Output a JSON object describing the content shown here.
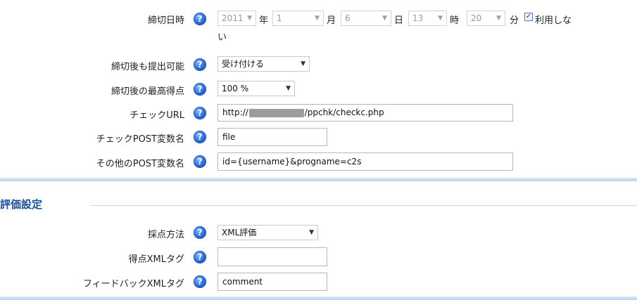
{
  "deadline": {
    "label": "締切日時",
    "year": "2011",
    "year_unit": "年",
    "month": "1",
    "month_unit": "月",
    "day": "6",
    "day_unit": "日",
    "hour": "13",
    "hour_unit": "時",
    "minute": "20",
    "minute_unit": "分",
    "disable_checked": true,
    "disable_label": "利用しな",
    "disable_label_wrap": "い"
  },
  "late_submission": {
    "label": "締切後も提出可能",
    "value": "受け付ける"
  },
  "late_max_score": {
    "label": "締切後の最高得点",
    "value": "100 %"
  },
  "check_url": {
    "label": "チェックURL",
    "value_prefix": "http://",
    "value_suffix": "/ppchk/checkc.php"
  },
  "check_post_var": {
    "label": "チェックPOST変数名",
    "value": "file"
  },
  "other_post_var": {
    "label": "その他のPOST変数名",
    "value": "id={username}&progname=c2s"
  },
  "evaluation": {
    "section_title": "評価設定",
    "scoring_method": {
      "label": "採点方法",
      "value": "XML評価"
    },
    "score_xml_tag": {
      "label": "得点XMLタグ",
      "value": ""
    },
    "feedback_xml_tag": {
      "label": "フィードバックXMLタグ",
      "value": "comment"
    }
  },
  "help_icon_glyph": "?",
  "colors": {
    "section_title": "#1a4f9c",
    "help_icon": "#2f6fe0",
    "divider": "#bcd4ef"
  }
}
